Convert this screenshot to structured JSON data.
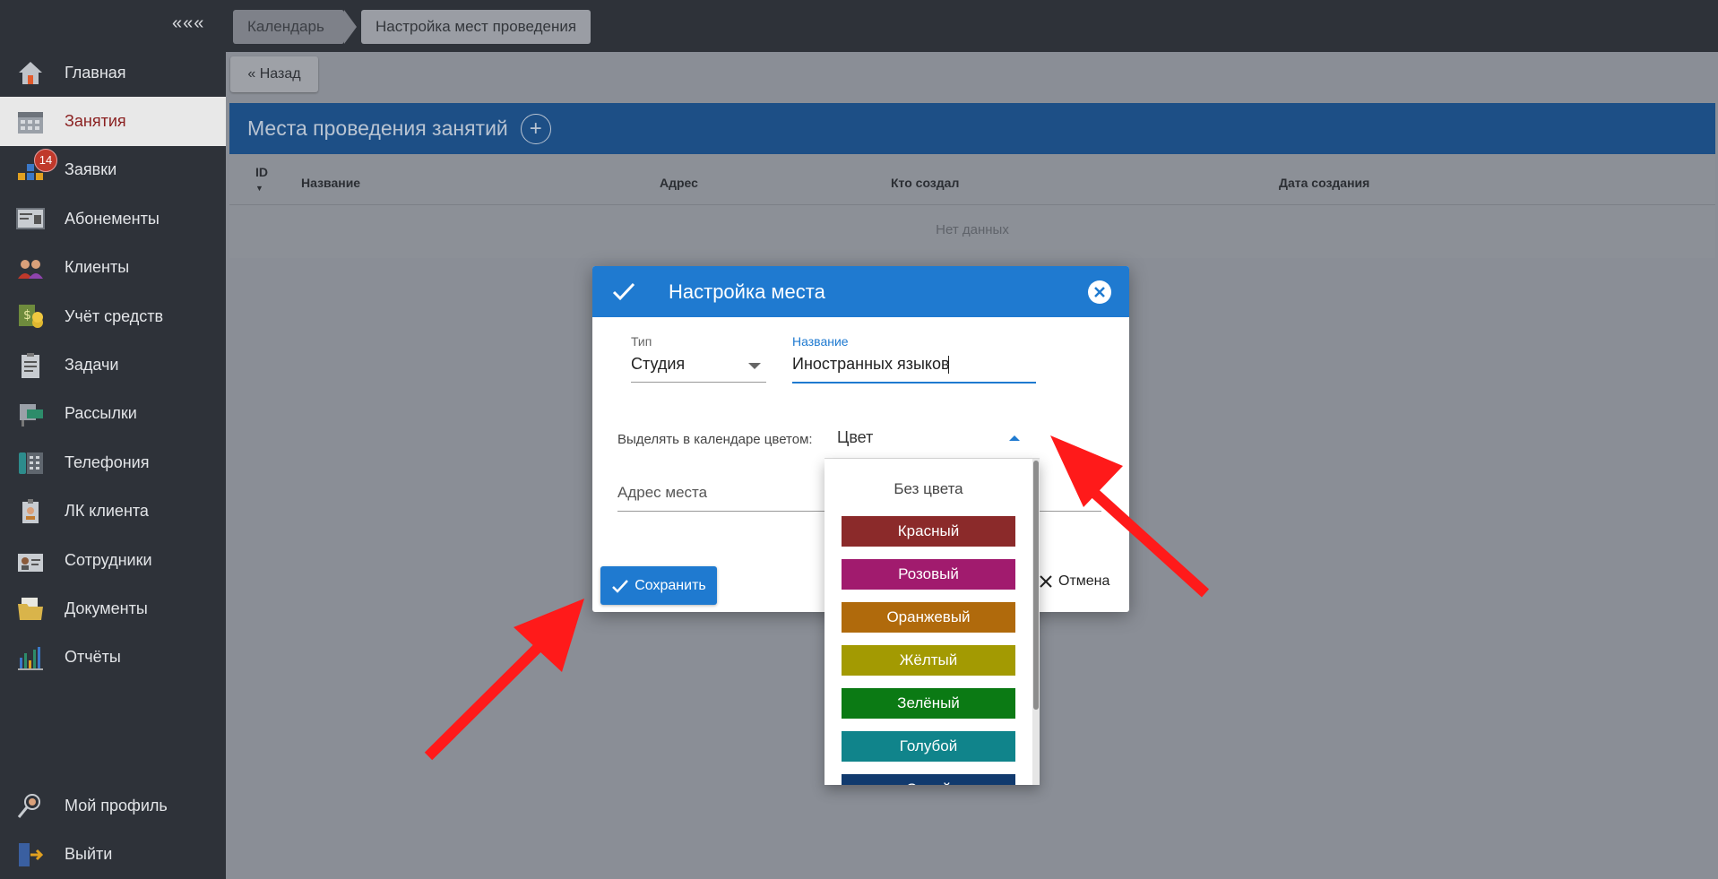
{
  "sidebar": {
    "collapse_label": "«««",
    "items": [
      {
        "label": "Главная",
        "icon": "home-icon"
      },
      {
        "label": "Занятия",
        "icon": "calendar-icon",
        "active": true
      },
      {
        "label": "Заявки",
        "icon": "requests-icon",
        "badge": "14"
      },
      {
        "label": "Абонементы",
        "icon": "subscription-card-icon"
      },
      {
        "label": "Клиенты",
        "icon": "clients-icon"
      },
      {
        "label": "Учёт средств",
        "icon": "money-icon"
      },
      {
        "label": "Задачи",
        "icon": "tasks-icon"
      },
      {
        "label": "Рассылки",
        "icon": "mailing-icon"
      },
      {
        "label": "Телефония",
        "icon": "phone-icon"
      },
      {
        "label": "ЛК клиента",
        "icon": "client-account-icon"
      },
      {
        "label": "Сотрудники",
        "icon": "staff-icon"
      },
      {
        "label": "Документы",
        "icon": "documents-icon"
      },
      {
        "label": "Отчёты",
        "icon": "reports-icon"
      }
    ],
    "bottom": [
      {
        "label": "Мой профиль",
        "icon": "profile-icon"
      },
      {
        "label": "Выйти",
        "icon": "logout-icon"
      }
    ]
  },
  "breadcrumb": {
    "items": [
      "Календарь",
      "Настройка мест проведения"
    ]
  },
  "back_button": "« Назад",
  "panel": {
    "title": "Места проведения занятий",
    "columns": [
      "ID",
      "Название",
      "Адрес",
      "Кто создал",
      "Дата создания"
    ],
    "empty_text": "Нет данных"
  },
  "modal": {
    "title": "Настройка места",
    "type_label": "Тип",
    "type_value": "Студия",
    "name_label": "Название",
    "name_value": "Иностранных языков",
    "color_label": "Выделять в календаре цветом:",
    "color_placeholder": "Цвет",
    "address_label": "Адрес места",
    "save_label": "Сохранить",
    "cancel_label": "Отмена"
  },
  "color_dropdown": {
    "none_label": "Без цвета",
    "options": [
      {
        "label": "Красный",
        "color": "#8b2a2a"
      },
      {
        "label": "Розовый",
        "color": "#a11b6e"
      },
      {
        "label": "Оранжевый",
        "color": "#b06a0c"
      },
      {
        "label": "Жёлтый",
        "color": "#a39a02"
      },
      {
        "label": "Зелёный",
        "color": "#0b7a14"
      },
      {
        "label": "Голубой",
        "color": "#10848b"
      },
      {
        "label": "Синий",
        "color": "#113a6e"
      }
    ]
  },
  "colors": {
    "accent": "#1f7ad0",
    "sidebar_bg": "#2e3239",
    "annotation_arrow": "#ff1a1a"
  }
}
